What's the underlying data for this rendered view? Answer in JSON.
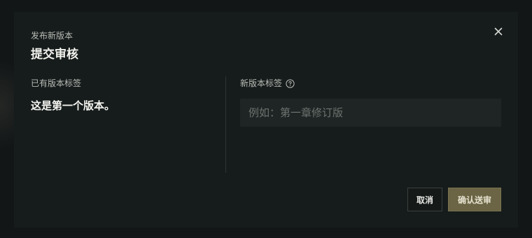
{
  "dialog": {
    "subtitle": "发布新版本",
    "title": "提交审核",
    "close_icon": "close-icon"
  },
  "existing_tags": {
    "label": "已有版本标签",
    "value": "这是第一个版本。"
  },
  "new_tag": {
    "label": "新版本标签",
    "help_icon": "question-circle-icon",
    "placeholder": "例如：第一章修订版",
    "value": ""
  },
  "footer": {
    "cancel_label": "取消",
    "confirm_label": "确认送审"
  },
  "colors": {
    "accent": "#6b6545",
    "dialog_bg": "#161c1b",
    "input_bg": "#1f2524"
  }
}
